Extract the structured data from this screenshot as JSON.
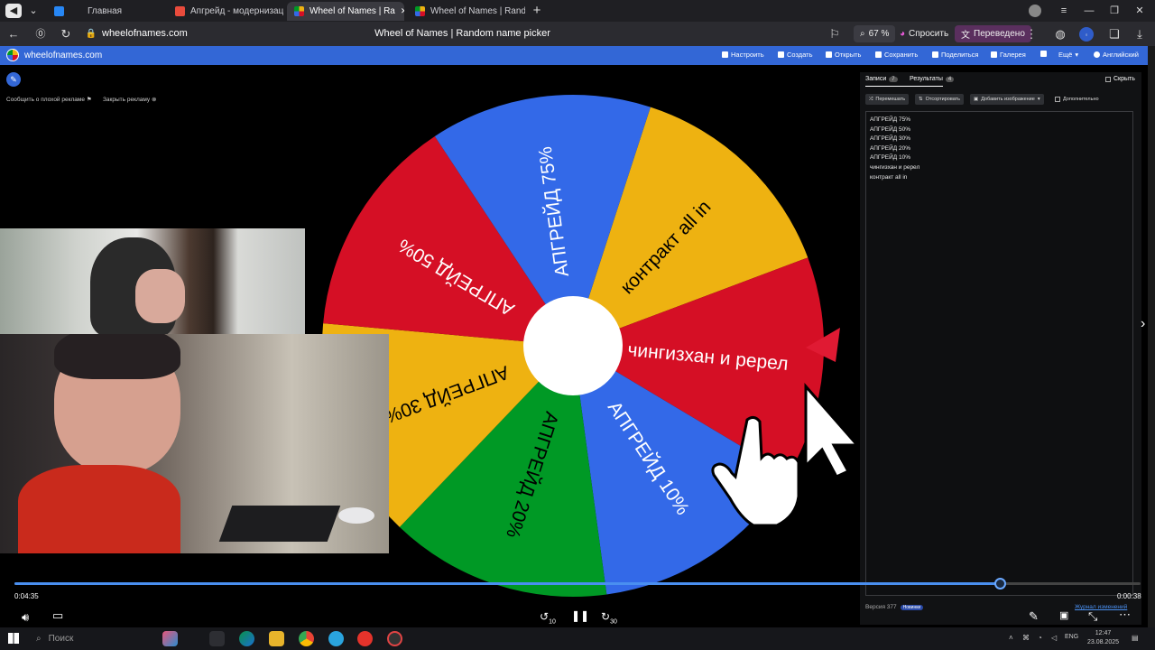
{
  "browser": {
    "tabs": [
      {
        "label": "Главная",
        "color": "#2787f5"
      },
      {
        "label": "Апгрейд - модернизаци",
        "color": "#e94b3c"
      },
      {
        "label": "Wheel of Names | Ra",
        "color": "#f5b400",
        "active": true
      },
      {
        "label": "Wheel of Names | Random",
        "color": "#f5b400"
      }
    ],
    "url": "wheelofnames.com",
    "page_title": "Wheel of Names | Random name picker",
    "zoom": "67 %",
    "ask_label": "Спросить",
    "translated_label": "Переведено"
  },
  "site": {
    "logo_text": "wheelofnames.com",
    "menu": [
      "Настроить",
      "Создать",
      "Открыть",
      "Сохранить",
      "Поделиться",
      "Галерея",
      "Ещё",
      "Английский"
    ],
    "report_ad": "Сообщить о плохой рекламе",
    "close_ad": "Закрыть рекламу"
  },
  "wheel": {
    "slices": [
      {
        "label": "контракт all in",
        "color": "#eeb211"
      },
      {
        "label": "чингизхан и ререл",
        "color": "#d50f25"
      },
      {
        "label": "АПГРЕЙД 10%",
        "color": "#3369e8"
      },
      {
        "label": "АПГРЕЙД 20%",
        "color": "#009925"
      },
      {
        "label": "АПГРЕЙД 30%",
        "color": "#eeb211"
      },
      {
        "label": "АПГРЕЙД 50%",
        "color": "#d50f25"
      },
      {
        "label": "АПГРЕЙД 75%",
        "color": "#3369e8"
      }
    ]
  },
  "panel": {
    "tab_entries": "Записи",
    "tab_entries_count": "7",
    "tab_results": "Результаты",
    "tab_results_count": "4",
    "hide_label": "Скрыть",
    "shuffle": "Перемешать",
    "sort": "Отсортировать",
    "add_image": "Добавить изображение",
    "advanced": "Дополнительно",
    "entries": [
      "АПГРЕЙД 75%",
      "АПГРЕЙД 50%",
      "АПГРЕЙД 30%",
      "АПГРЕЙД 20%",
      "АПГРЕЙД 10%",
      "чингизхан и ререл",
      "контракт all in"
    ],
    "version": "Версия 377",
    "version_badge": "Новинки",
    "changelog": "Журнал изменений"
  },
  "player": {
    "elapsed": "0:04:35",
    "remaining": "0:00:38",
    "progress": 0.875,
    "rewind": "10",
    "forward": "30"
  },
  "taskbar": {
    "search_placeholder": "Поиск",
    "lang": "ENG",
    "time": "12:47",
    "date": "23.08.2025"
  }
}
